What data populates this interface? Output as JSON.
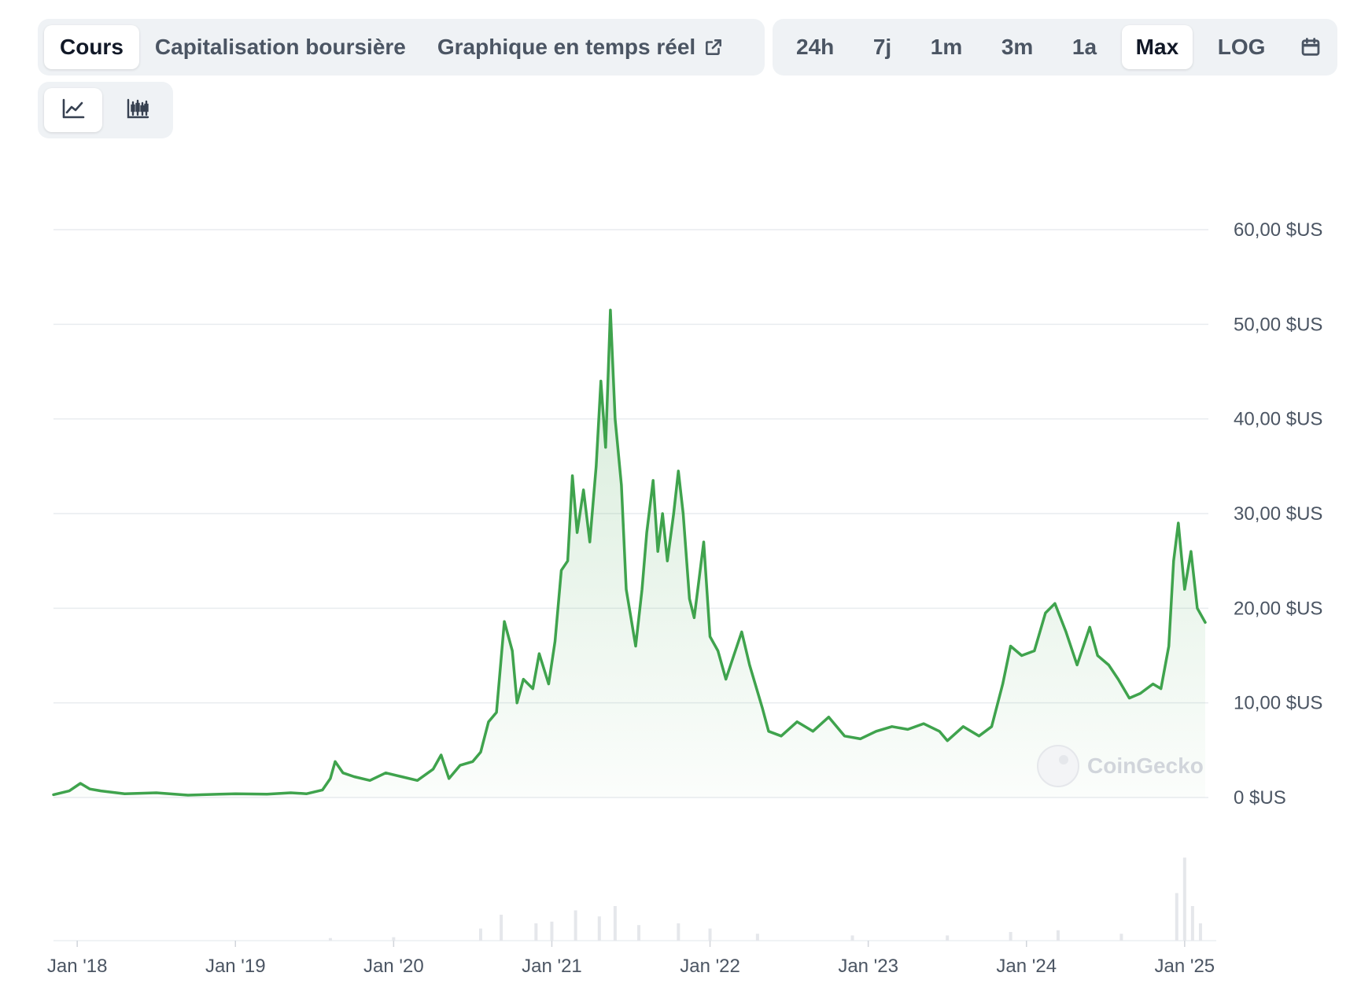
{
  "tabs": {
    "price": "Cours",
    "market_cap": "Capitalisation boursière",
    "live_chart": "Graphique en temps réel"
  },
  "ranges": [
    "24h",
    "7j",
    "1m",
    "3m",
    "1a",
    "Max",
    "LOG"
  ],
  "active_range": "Max",
  "icons": {
    "external": "external-link-icon",
    "calendar": "calendar-icon",
    "line_view": "line-chart-icon",
    "candle_view": "candlestick-icon"
  },
  "watermark": "CoinGecko",
  "colors": {
    "line": "#3fa34d",
    "area_top": "#3fa34d",
    "grid": "#e9ecef",
    "volume": "#e5e7eb"
  },
  "chart_data": {
    "type": "area",
    "ylim": [
      0,
      60
    ],
    "y_ticks": [
      {
        "value": 60,
        "label": "60,00 $US"
      },
      {
        "value": 50,
        "label": "50,00 $US"
      },
      {
        "value": 40,
        "label": "40,00 $US"
      },
      {
        "value": 30,
        "label": "30,00 $US"
      },
      {
        "value": 20,
        "label": "20,00 $US"
      },
      {
        "value": 10,
        "label": "10,00 $US"
      },
      {
        "value": 0,
        "label": "0 $US"
      }
    ],
    "x_ticks": [
      {
        "value": 2018.0,
        "label": "Jan '18"
      },
      {
        "value": 2019.0,
        "label": "Jan '19"
      },
      {
        "value": 2020.0,
        "label": "Jan '20"
      },
      {
        "value": 2021.0,
        "label": "Jan '21"
      },
      {
        "value": 2022.0,
        "label": "Jan '22"
      },
      {
        "value": 2023.0,
        "label": "Jan '23"
      },
      {
        "value": 2024.0,
        "label": "Jan '24"
      },
      {
        "value": 2025.0,
        "label": "Jan '25"
      }
    ],
    "xlim": [
      2017.85,
      2025.15
    ],
    "series": [
      {
        "points": [
          [
            2017.85,
            0.3
          ],
          [
            2017.95,
            0.7
          ],
          [
            2018.02,
            1.5
          ],
          [
            2018.08,
            0.9
          ],
          [
            2018.15,
            0.7
          ],
          [
            2018.3,
            0.4
          ],
          [
            2018.5,
            0.5
          ],
          [
            2018.7,
            0.25
          ],
          [
            2018.9,
            0.35
          ],
          [
            2019.0,
            0.4
          ],
          [
            2019.2,
            0.35
          ],
          [
            2019.35,
            0.5
          ],
          [
            2019.45,
            0.4
          ],
          [
            2019.55,
            0.8
          ],
          [
            2019.6,
            2.0
          ],
          [
            2019.63,
            3.8
          ],
          [
            2019.68,
            2.6
          ],
          [
            2019.75,
            2.2
          ],
          [
            2019.85,
            1.8
          ],
          [
            2019.95,
            2.6
          ],
          [
            2020.05,
            2.2
          ],
          [
            2020.15,
            1.8
          ],
          [
            2020.25,
            3.0
          ],
          [
            2020.3,
            4.5
          ],
          [
            2020.35,
            2.0
          ],
          [
            2020.42,
            3.4
          ],
          [
            2020.5,
            3.8
          ],
          [
            2020.55,
            4.8
          ],
          [
            2020.6,
            8.0
          ],
          [
            2020.65,
            9.0
          ],
          [
            2020.7,
            18.6
          ],
          [
            2020.75,
            15.5
          ],
          [
            2020.78,
            10.0
          ],
          [
            2020.82,
            12.5
          ],
          [
            2020.88,
            11.5
          ],
          [
            2020.92,
            15.2
          ],
          [
            2020.98,
            12.0
          ],
          [
            2021.02,
            16.5
          ],
          [
            2021.06,
            24.0
          ],
          [
            2021.1,
            25.0
          ],
          [
            2021.13,
            34.0
          ],
          [
            2021.16,
            28.0
          ],
          [
            2021.2,
            32.5
          ],
          [
            2021.24,
            27.0
          ],
          [
            2021.28,
            35.0
          ],
          [
            2021.31,
            44.0
          ],
          [
            2021.34,
            37.0
          ],
          [
            2021.37,
            51.5
          ],
          [
            2021.4,
            40.0
          ],
          [
            2021.44,
            33.0
          ],
          [
            2021.47,
            22.0
          ],
          [
            2021.5,
            19.0
          ],
          [
            2021.53,
            16.0
          ],
          [
            2021.57,
            22.0
          ],
          [
            2021.6,
            28.0
          ],
          [
            2021.64,
            33.5
          ],
          [
            2021.67,
            26.0
          ],
          [
            2021.7,
            30.0
          ],
          [
            2021.73,
            25.0
          ],
          [
            2021.77,
            30.0
          ],
          [
            2021.8,
            34.5
          ],
          [
            2021.83,
            30.0
          ],
          [
            2021.87,
            21.0
          ],
          [
            2021.9,
            19.0
          ],
          [
            2021.93,
            23.0
          ],
          [
            2021.96,
            27.0
          ],
          [
            2022.0,
            17.0
          ],
          [
            2022.05,
            15.5
          ],
          [
            2022.1,
            12.5
          ],
          [
            2022.15,
            15.0
          ],
          [
            2022.2,
            17.5
          ],
          [
            2022.25,
            14.0
          ],
          [
            2022.33,
            9.5
          ],
          [
            2022.37,
            7.0
          ],
          [
            2022.45,
            6.5
          ],
          [
            2022.55,
            8.0
          ],
          [
            2022.65,
            7.0
          ],
          [
            2022.75,
            8.5
          ],
          [
            2022.85,
            6.5
          ],
          [
            2022.95,
            6.2
          ],
          [
            2023.05,
            7.0
          ],
          [
            2023.15,
            7.5
          ],
          [
            2023.25,
            7.2
          ],
          [
            2023.35,
            7.8
          ],
          [
            2023.45,
            7.0
          ],
          [
            2023.5,
            6.0
          ],
          [
            2023.6,
            7.5
          ],
          [
            2023.7,
            6.5
          ],
          [
            2023.78,
            7.5
          ],
          [
            2023.85,
            12.0
          ],
          [
            2023.9,
            16.0
          ],
          [
            2023.97,
            15.0
          ],
          [
            2024.05,
            15.5
          ],
          [
            2024.12,
            19.5
          ],
          [
            2024.18,
            20.5
          ],
          [
            2024.25,
            17.5
          ],
          [
            2024.32,
            14.0
          ],
          [
            2024.4,
            18.0
          ],
          [
            2024.45,
            15.0
          ],
          [
            2024.52,
            14.0
          ],
          [
            2024.58,
            12.5
          ],
          [
            2024.65,
            10.5
          ],
          [
            2024.72,
            11.0
          ],
          [
            2024.8,
            12.0
          ],
          [
            2024.85,
            11.5
          ],
          [
            2024.9,
            16.0
          ],
          [
            2024.93,
            25.0
          ],
          [
            2024.96,
            29.0
          ],
          [
            2025.0,
            22.0
          ],
          [
            2025.04,
            26.0
          ],
          [
            2025.08,
            20.0
          ],
          [
            2025.13,
            18.5
          ]
        ]
      }
    ],
    "volume": [
      [
        2019.6,
        3
      ],
      [
        2020.0,
        4
      ],
      [
        2020.55,
        14
      ],
      [
        2020.68,
        30
      ],
      [
        2020.9,
        20
      ],
      [
        2021.0,
        22
      ],
      [
        2021.15,
        35
      ],
      [
        2021.3,
        28
      ],
      [
        2021.4,
        40
      ],
      [
        2021.55,
        18
      ],
      [
        2021.8,
        20
      ],
      [
        2022.0,
        14
      ],
      [
        2022.3,
        8
      ],
      [
        2022.9,
        6
      ],
      [
        2023.5,
        6
      ],
      [
        2023.9,
        10
      ],
      [
        2024.2,
        12
      ],
      [
        2024.6,
        8
      ],
      [
        2024.95,
        55
      ],
      [
        2025.0,
        96
      ],
      [
        2025.05,
        40
      ],
      [
        2025.1,
        20
      ]
    ]
  }
}
